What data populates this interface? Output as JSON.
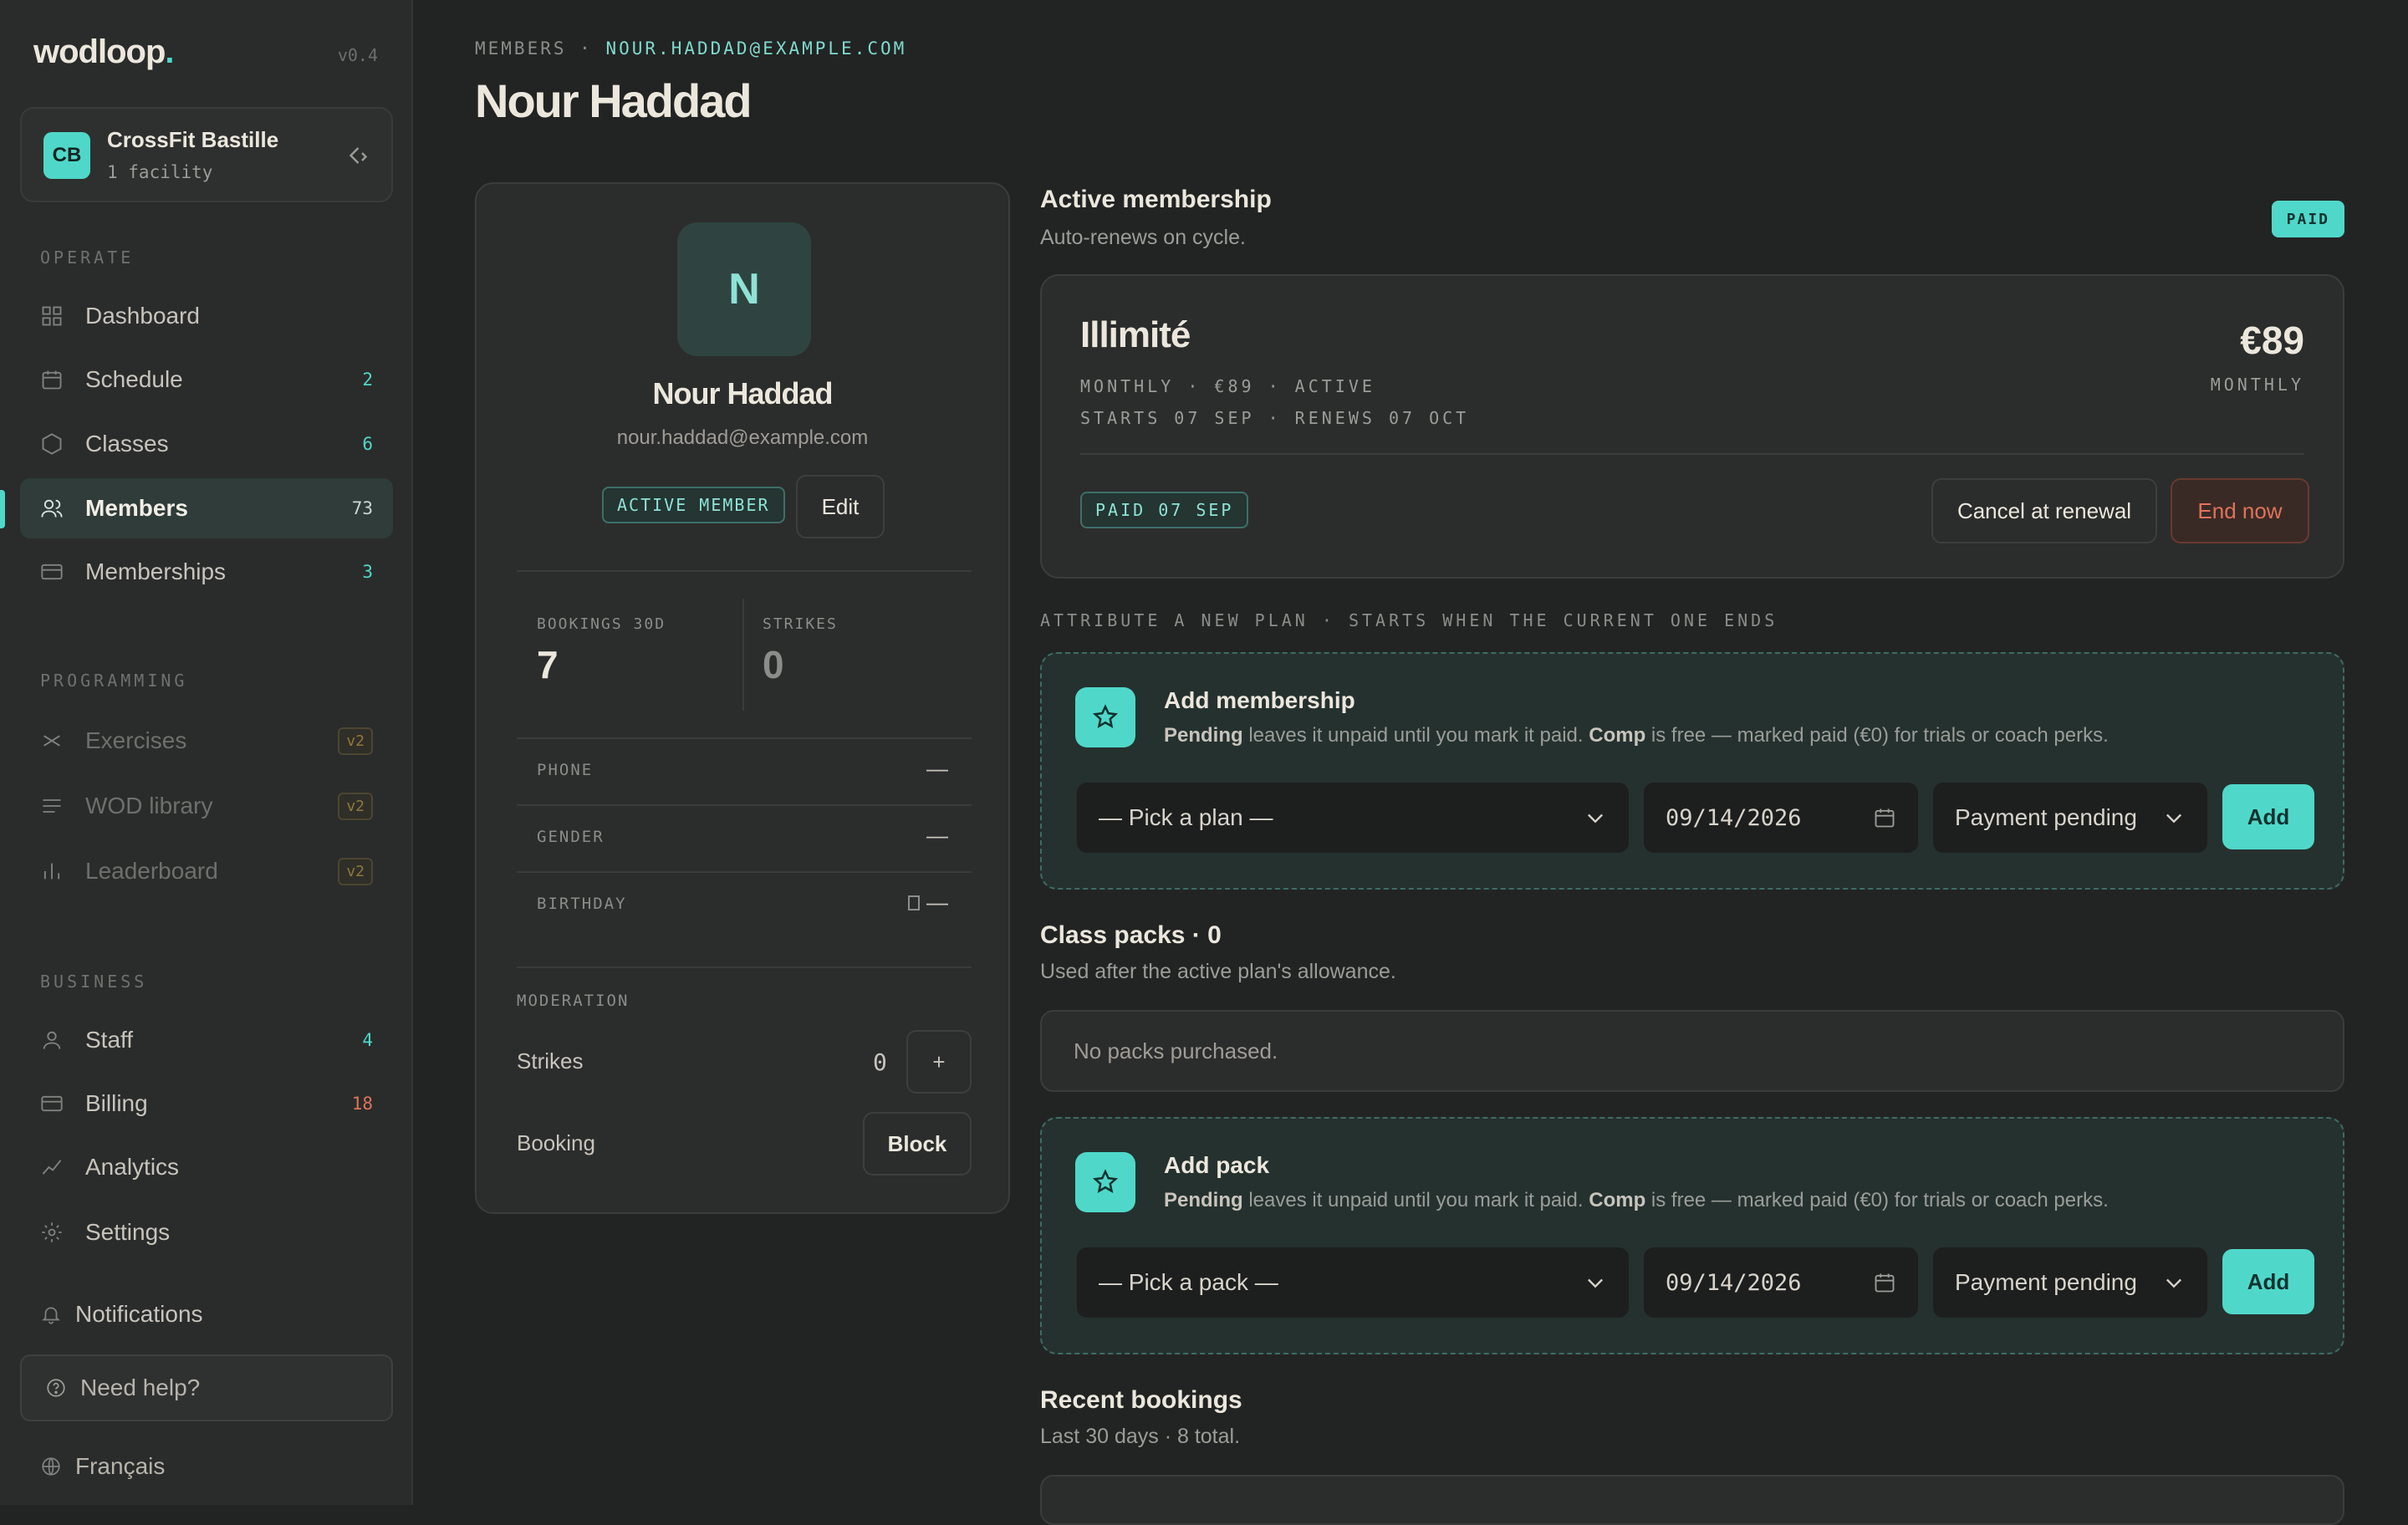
{
  "sidebar": {
    "brand": "wodloop",
    "brand_dot": ".",
    "version": "v0.4",
    "facility": {
      "badge": "CB",
      "name": "CrossFit Bastille",
      "sub": "1 facility"
    },
    "sections": {
      "operate": "OPERATE",
      "programming": "PROGRAMMING",
      "business": "BUSINESS"
    },
    "operate_items": [
      {
        "label": "Dashboard",
        "icon": "grid-icon"
      },
      {
        "label": "Schedule",
        "icon": "calendar-icon",
        "count": "2"
      },
      {
        "label": "Classes",
        "icon": "hexagon-icon",
        "count": "6"
      },
      {
        "label": "Members",
        "icon": "users-icon",
        "count": "73",
        "active": true
      },
      {
        "label": "Memberships",
        "icon": "card-icon",
        "count": "3"
      }
    ],
    "programming_items": [
      {
        "label": "Exercises",
        "icon": "dumbbell-icon",
        "tag": "v2"
      },
      {
        "label": "WOD library",
        "icon": "list-icon",
        "tag": "v2"
      },
      {
        "label": "Leaderboard",
        "icon": "bar-chart-icon",
        "tag": "v2"
      }
    ],
    "business_items": [
      {
        "label": "Staff",
        "icon": "user-icon",
        "count": "4"
      },
      {
        "label": "Billing",
        "icon": "card-icon",
        "count": "18",
        "count_color": "#e0735a"
      },
      {
        "label": "Analytics",
        "icon": "trend-icon"
      },
      {
        "label": "Settings",
        "icon": "gear-icon"
      }
    ],
    "notifications": "Notifications",
    "help": "Need help?",
    "language": "Français"
  },
  "header": {
    "crumb_parent": "MEMBERS",
    "crumb_sep": "·",
    "crumb_current": "NOUR.HADDAD@EXAMPLE.COM",
    "title": "Nour Haddad"
  },
  "profile": {
    "avatar_letter": "N",
    "name": "Nour Haddad",
    "email": "nour.haddad@example.com",
    "status_badge": "ACTIVE MEMBER",
    "edit_label": "Edit",
    "stats": {
      "bookings_label": "BOOKINGS 30D",
      "bookings_value": "7",
      "strikes_label": "STRIKES",
      "strikes_value": "0"
    },
    "fields": {
      "phone_label": "PHONE",
      "phone_value": "—",
      "gender_label": "GENDER",
      "gender_value": "—",
      "birthday_label": "BIRTHDAY",
      "birthday_value": "—"
    },
    "moderation": {
      "label": "MODERATION",
      "strikes_label": "Strikes",
      "strikes_value": "0",
      "plus_label": "+",
      "booking_label": "Booking",
      "block_label": "Block"
    }
  },
  "membership": {
    "title": "Active membership",
    "subtitle": "Auto-renews on cycle.",
    "status_pill": "PAID",
    "plan_name": "Illimité",
    "price": "€89",
    "period": "MONTHLY",
    "meta_line1": "MONTHLY · €89 · ACTIVE",
    "meta_line2": "STARTS 07 SEP · RENEWS 07 OCT",
    "paid_tag": "PAID 07 SEP",
    "cancel_label": "Cancel at renewal",
    "end_label": "End now"
  },
  "attribute_label": "ATTRIBUTE A NEW PLAN · STARTS WHEN THE CURRENT ONE ENDS",
  "add_membership": {
    "title": "Add membership",
    "desc_pending": "Pending",
    "desc_mid": " leaves it unpaid until you mark it paid. ",
    "desc_comp": "Comp",
    "desc_end": " is free — marked paid (€0) for trials or coach perks.",
    "plan_placeholder": "— Pick a plan —",
    "date": "09/14/2026",
    "payment": "Payment pending",
    "add_label": "Add"
  },
  "class_packs": {
    "title": "Class packs · 0",
    "subtitle": "Used after the active plan's allowance.",
    "empty": "No packs purchased."
  },
  "add_pack": {
    "title": "Add pack",
    "desc_pending": "Pending",
    "desc_mid": " leaves it unpaid until you mark it paid. ",
    "desc_comp": "Comp",
    "desc_end": " is free — marked paid (€0) for trials or coach perks.",
    "pack_placeholder": "— Pick a pack —",
    "date": "09/14/2026",
    "payment": "Payment pending",
    "add_label": "Add"
  },
  "recent_bookings": {
    "title": "Recent bookings",
    "subtitle": "Last 30 days · 8 total."
  },
  "colors": {
    "accent": "#4fd8c9",
    "danger": "#e0735a",
    "bg": "#222423",
    "panel": "#2b2d2c"
  }
}
